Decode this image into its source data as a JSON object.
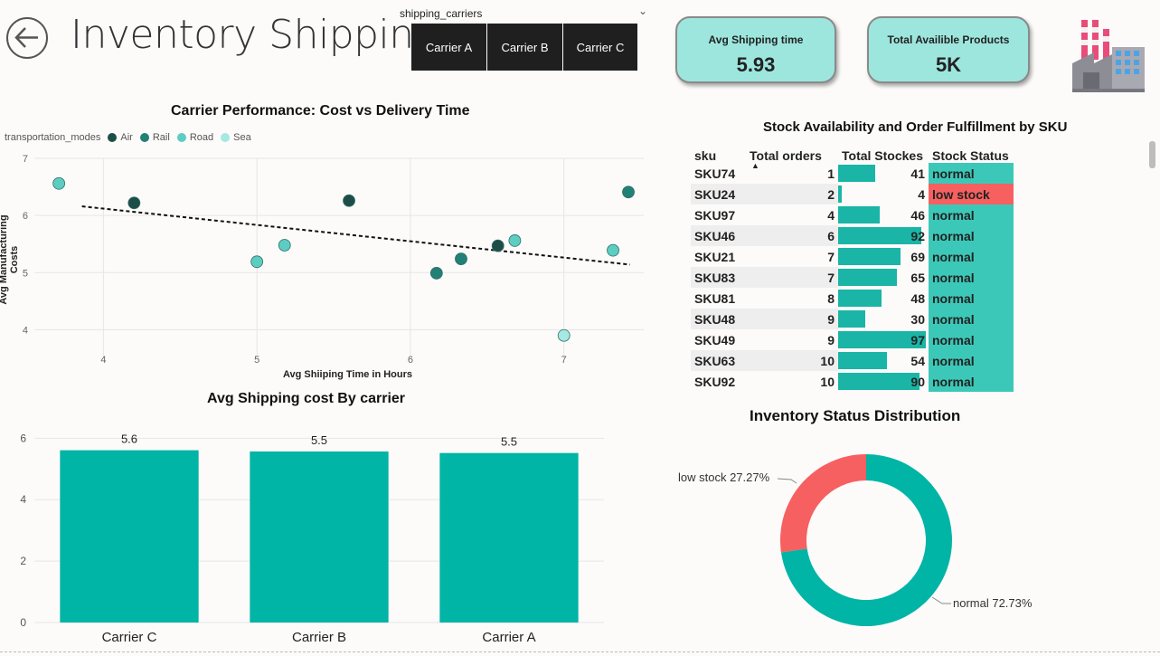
{
  "header": {
    "title": "Inventory Shipping",
    "slicer_label": "shipping_carriers",
    "carriers": [
      "Carrier A",
      "Carrier B",
      "Carrier C"
    ]
  },
  "kpis": [
    {
      "label": "Avg Shipping time",
      "value": "5.93"
    },
    {
      "label": "Total Availible Products",
      "value": "5K"
    }
  ],
  "colors": {
    "air": "#1e4d48",
    "rail": "#238076",
    "road": "#5dcdc2",
    "sea": "#a6e8e2",
    "bar": "#00b4a6",
    "low": "#f76060",
    "normal": "#3cc8b8"
  },
  "icons": {
    "back": "arrow-left-icon",
    "factory": "factory-icon",
    "sort": "sort-ascending-icon"
  },
  "scatter": {
    "title": "Carrier Performance: Cost vs Delivery Time",
    "legend_title": "transportation_modes",
    "xlabel": "Avg Shiiping Time in Hours",
    "ylabel": "Avg Manufacturing Costs"
  },
  "bar": {
    "title": "Avg Shipping cost By carrier"
  },
  "table": {
    "title": "Stock Availability and Order Fulfillment by SKU",
    "headers": [
      "sku",
      "Total orders",
      "Total Stockes",
      "Stock Status"
    ]
  },
  "donut": {
    "title": "Inventory Status Distribution"
  },
  "chart_data": [
    {
      "type": "scatter",
      "title": "Carrier Performance: Cost vs Delivery Time",
      "xlabel": "Avg Shiiping Time in Hours",
      "ylabel": "Avg Manufacturing Costs",
      "xlim": [
        3.55,
        7.52
      ],
      "ylim": [
        3.5,
        7
      ],
      "xticks": [
        4,
        5,
        6,
        7
      ],
      "yticks": [
        4,
        5,
        6,
        7
      ],
      "grid": true,
      "legend": "top-left",
      "series": [
        {
          "name": "Air",
          "color": "#1e4d48",
          "points": [
            [
              4.2,
              6.22
            ],
            [
              5.6,
              6.26
            ],
            [
              6.57,
              5.47
            ]
          ]
        },
        {
          "name": "Rail",
          "color": "#238076",
          "points": [
            [
              6.17,
              4.99
            ],
            [
              6.33,
              5.24
            ],
            [
              7.42,
              6.41
            ]
          ]
        },
        {
          "name": "Road",
          "color": "#5dcdc2",
          "points": [
            [
              3.71,
              6.56
            ],
            [
              5.0,
              5.19
            ],
            [
              5.18,
              5.48
            ],
            [
              6.68,
              5.56
            ],
            [
              7.32,
              5.39
            ]
          ]
        },
        {
          "name": "Sea",
          "color": "#a6e8e2",
          "points": [
            [
              7.0,
              3.9
            ]
          ]
        }
      ],
      "trendline": [
        [
          3.86,
          6.16
        ],
        [
          7.43,
          5.14
        ]
      ]
    },
    {
      "type": "bar",
      "title": "Avg Shipping cost By carrier",
      "categories": [
        "Carrier C",
        "Carrier B",
        "Carrier A"
      ],
      "values": [
        5.6,
        5.5,
        5.5
      ],
      "value_positions": [
        5.61,
        5.57,
        5.52
      ],
      "ylim": [
        0,
        6.6
      ],
      "yticks": [
        0,
        2,
        4,
        6
      ],
      "grid": true
    },
    {
      "type": "table",
      "title": "Stock Availability and Order Fulfillment by SKU",
      "columns": [
        "sku",
        "Total orders",
        "Total Stockes",
        "Stock Status"
      ],
      "stock_max": 100,
      "rows": [
        [
          "SKU74",
          1,
          41,
          "normal"
        ],
        [
          "SKU24",
          2,
          4,
          "low stock"
        ],
        [
          "SKU97",
          4,
          46,
          "normal"
        ],
        [
          "SKU46",
          6,
          92,
          "normal"
        ],
        [
          "SKU21",
          7,
          69,
          "normal"
        ],
        [
          "SKU83",
          7,
          65,
          "normal"
        ],
        [
          "SKU81",
          8,
          48,
          "normal"
        ],
        [
          "SKU48",
          9,
          30,
          "normal"
        ],
        [
          "SKU49",
          9,
          97,
          "normal"
        ],
        [
          "SKU63",
          10,
          54,
          "normal"
        ],
        [
          "SKU92",
          10,
          90,
          "normal"
        ]
      ]
    },
    {
      "type": "pie",
      "title": "Inventory Status Distribution",
      "donut": true,
      "slices": [
        {
          "label": "low stock",
          "value": 27.27,
          "text": "low stock 27.27%",
          "color": "#f76060"
        },
        {
          "label": "normal",
          "value": 72.73,
          "text": "normal 72.73%",
          "color": "#00b4a6"
        }
      ]
    }
  ]
}
